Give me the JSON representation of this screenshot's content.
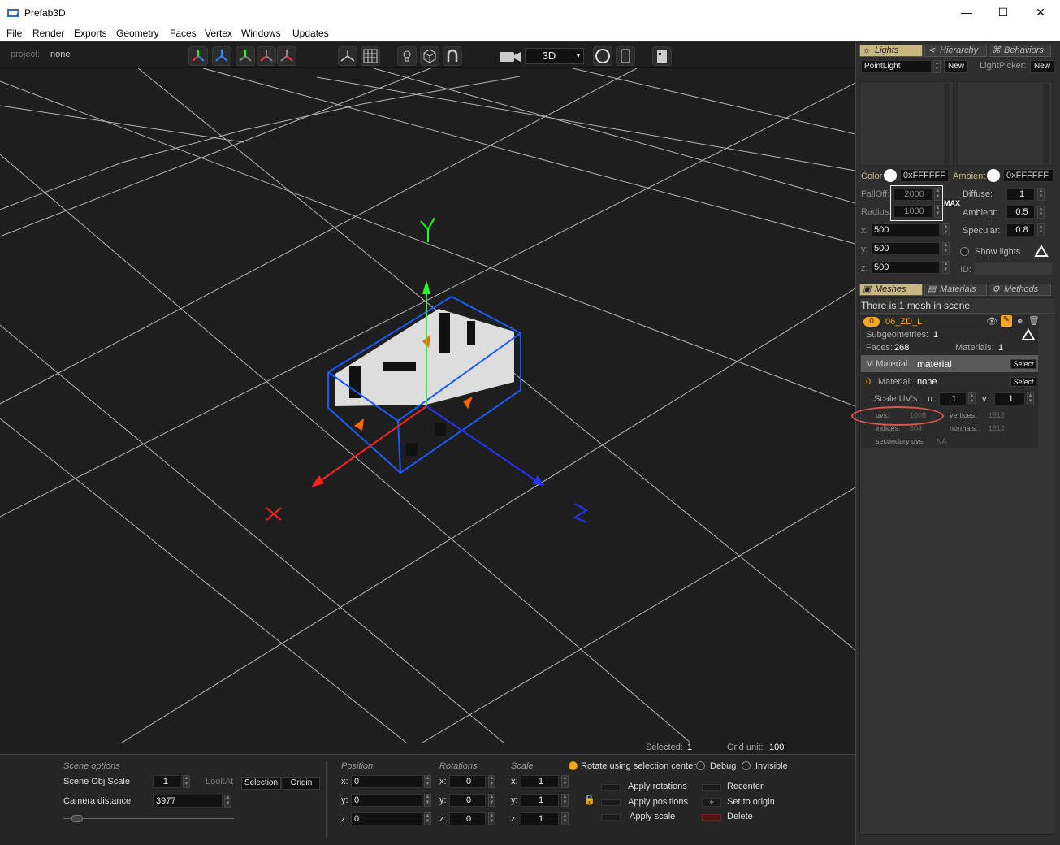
{
  "app": {
    "title": "Prefab3D"
  },
  "window_controls": {
    "minimize": "—",
    "maximize": "☐",
    "close": "✕"
  },
  "menu": [
    "File",
    "Render",
    "Exports",
    "Geometry",
    "Faces",
    "Vertex",
    "Windows",
    "Updates"
  ],
  "toolbar": {
    "project_label": "project:",
    "project_value": "none",
    "view_mode": "3D"
  },
  "viewport": {
    "axis_y": "Y",
    "axis_x": "X",
    "axis_z": "Z"
  },
  "status": {
    "selected_label": "Selected:",
    "selected_value": "1",
    "grid_unit_label": "Grid unit:",
    "grid_unit_value": "100"
  },
  "scene_options": {
    "heading": "Scene options",
    "obj_scale_label": "Scene Obj Scale",
    "obj_scale_value": "1",
    "lookat_label": "LookAt",
    "selection_btn": "Selection",
    "origin_btn": "Origin",
    "camera_distance_label": "Camera distance",
    "camera_distance_value": "3977"
  },
  "transform": {
    "position_heading": "Position",
    "rotations_heading": "Rotations",
    "scale_heading": "Scale",
    "position": {
      "x": "0",
      "y": "0",
      "z": "0"
    },
    "rotations": {
      "x": "0",
      "y": "0",
      "z": "0"
    },
    "scale": {
      "x": "1",
      "y": "1",
      "z": "1"
    }
  },
  "options": {
    "rotate_center": "Rotate using selection center",
    "debug": "Debug",
    "invisible": "Invisible"
  },
  "actions": {
    "apply_rotations": "Apply rotations",
    "apply_positions": "Apply positions",
    "apply_scale": "Apply scale",
    "recenter": "Recenter",
    "set_to_origin": "Set to origin",
    "delete": "Delete"
  },
  "lights_panel": {
    "tabs": [
      "Lights",
      "Hierarchy",
      "Behaviors"
    ],
    "light_type": "PointLight",
    "new_btn": "New",
    "lightpicker_label": "LightPicker:",
    "new_btn2": "New",
    "color_label": "Color",
    "color_value": "0xFFFFFF",
    "ambient_label": "Ambient",
    "ambient_value": "0xFFFFFF",
    "falloff_label": "FallOff:",
    "falloff_value": "2000",
    "radius_label": "Radius:",
    "radius_value": "1000",
    "max_label": "MAX",
    "diffuse_label": "Diffuse:",
    "diffuse_value": "1",
    "ambient2_label": "Ambient:",
    "ambient2_value": "0.5",
    "specular_label": "Specular:",
    "specular_value": "0.8",
    "x_label": "x:",
    "x_value": "500",
    "y_label": "y:",
    "y_value": "500",
    "z_label": "z:",
    "z_value": "500",
    "show_lights": "Show lights",
    "id_label": "ID:"
  },
  "meshes_panel": {
    "tabs": [
      "Meshes",
      "Materials",
      "Methods"
    ],
    "scene_count": "There is 1 mesh in scene",
    "mesh_index": "0",
    "mesh_name": "06_ZD_L",
    "subgeometries_label": "Subgeometries:",
    "subgeometries_value": "1",
    "faces_label": "Faces:",
    "faces_value": "268",
    "materials_label": "Materials:",
    "materials_value": "1",
    "m_material_label": "M Material:",
    "m_material_value": "material",
    "select_btn": "Select",
    "sub_index": "0",
    "sub_material_label": "Material:",
    "sub_material_value": "none",
    "select_btn2": "Select",
    "scale_uvs_label": "Scale UV's",
    "u_label": "u:",
    "u_value": "1",
    "v_label": "v:",
    "v_value": "1",
    "uvs_label": "uvs:",
    "uvs_value": "1008",
    "vertices_label": "vertices:",
    "vertices_value": "1512",
    "indices_label": "indices:",
    "indices_value": "804",
    "normals_label": "normals:",
    "normals_value": "1512",
    "secondary_uvs_label": "secondary uvs:",
    "secondary_uvs_value": "NA"
  }
}
